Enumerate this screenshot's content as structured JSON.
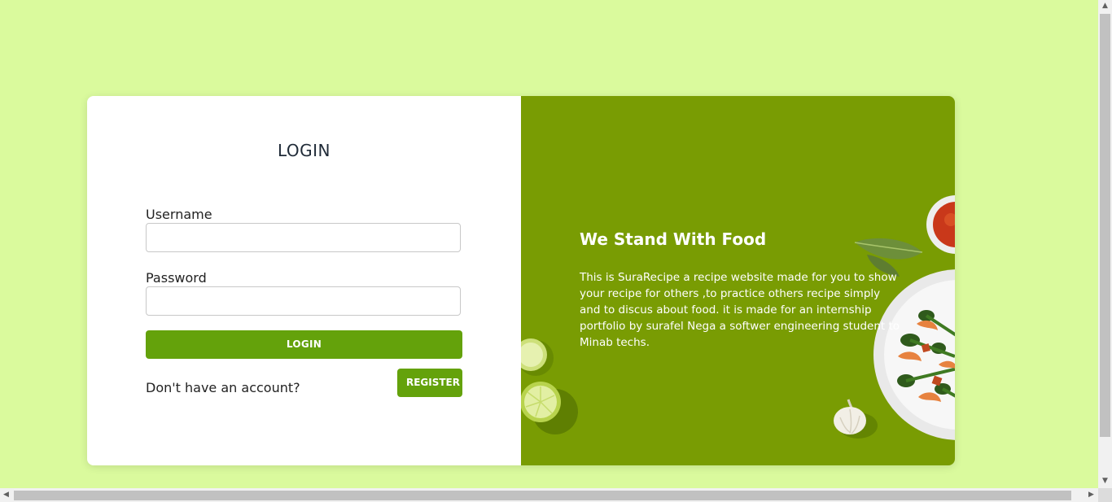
{
  "login": {
    "title": "LOGIN",
    "username_label": "Username",
    "username_value": "",
    "password_label": "Password",
    "password_value": "",
    "login_button": "LOGIN",
    "no_account_text": "Don't have an account?",
    "register_button": "REGISTER"
  },
  "promo": {
    "title": "We Stand With Food",
    "description": "This is SuraRecipe a recipe website made for you to show your recipe for others ,to practice others recipe simply and to discus about food. it is made for an internship portfolio by surafel Nega a softwer engineering student to Minab techs."
  },
  "colors": {
    "page_background": "#dafa9d",
    "panel_green": "#799c03",
    "button_green": "#64a20b"
  },
  "icons": {
    "scroll_up": "scroll-up-arrow-icon",
    "scroll_down": "scroll-down-arrow-icon",
    "scroll_left": "scroll-left-arrow-icon",
    "scroll_right": "scroll-right-arrow-icon"
  }
}
